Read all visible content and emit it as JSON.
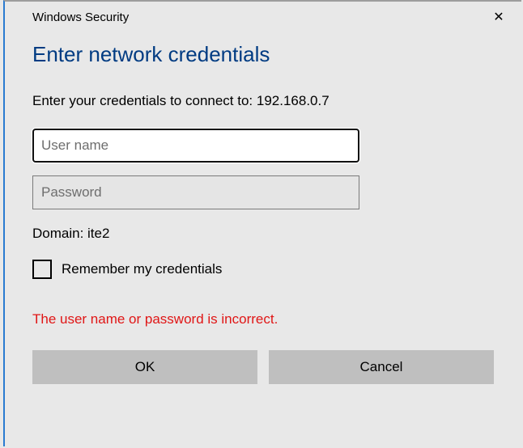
{
  "titlebar": {
    "title": "Windows Security",
    "close_glyph": "✕"
  },
  "heading": "Enter network credentials",
  "instruction": "Enter your credentials to connect to: 192.168.0.7",
  "fields": {
    "username_placeholder": "User name",
    "username_value": "",
    "password_placeholder": "Password",
    "password_value": ""
  },
  "domain_line": "Domain: ite2",
  "remember_label": "Remember my credentials",
  "error_message": "The user name or password is incorrect.",
  "buttons": {
    "ok": "OK",
    "cancel": "Cancel"
  }
}
